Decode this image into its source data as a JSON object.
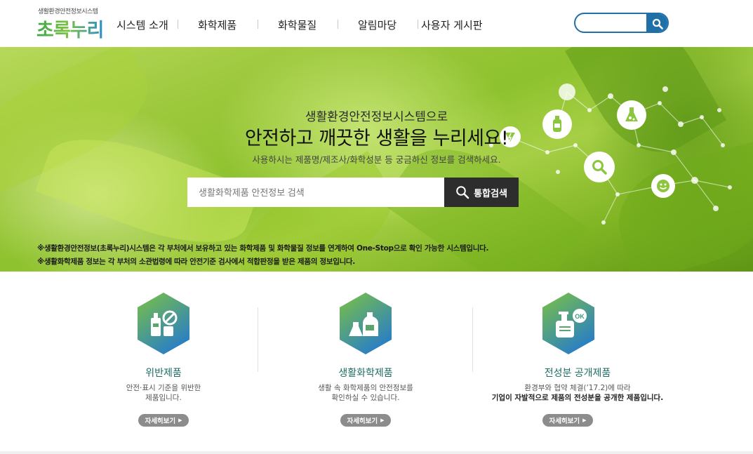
{
  "header": {
    "logo_sub": "생활환경안전정보시스템",
    "logo_main": "초록누리",
    "nav": [
      "시스템 소개",
      "화학제품",
      "화학물질",
      "알림마당",
      "사용자 게시판"
    ],
    "search_placeholder": ""
  },
  "hero": {
    "subtitle": "생활환경안전정보시스템으로",
    "title": "안전하고 깨끗한 생활을 누리세요!",
    "description": "사용하시는 제품명/제조사/화학성분 등 궁금하신 정보를 검색하세요.",
    "search_placeholder": "생활화학제품 안전정보 검색",
    "search_button": "통합검색",
    "notes": [
      "※생활환경안전정보(초록누리)시스템은 각 부처에서 보유하고 있는 화학제품 및 화학물질 정보를 연계하여 One-Stop으로 확인 가능한 시스템입니다.",
      "※생활화학제품 정보는 각 부처의 소관법령에 따라 안전기준 검사에서 적합판정을 받은 제품의 정보입니다."
    ],
    "icons": [
      "bottle-icon",
      "flask-icon",
      "lightning-icon",
      "magnifier-icon",
      "smiley-icon"
    ]
  },
  "cards": [
    {
      "title": "위반제품",
      "desc_line1": "안전·표시 기준을 위반한",
      "desc_line2": "제품입니다.",
      "button": "자세히보기",
      "icon": "prohibited-product-icon"
    },
    {
      "title": "생활화학제품",
      "desc_line1": "생활 속 화학제품의 안전정보를",
      "desc_line2": "확인하실 수 있습니다.",
      "button": "자세히보기",
      "icon": "chemical-products-icon"
    },
    {
      "title": "전성분 공개제품",
      "desc_line1": "환경부와 협약 체결(’17.2)에 따라",
      "desc_line2": "기업이 자발적으로 제품의 전성분을 공개한 제품입니다.",
      "button": "자세히보기",
      "icon": "ok-product-icon"
    }
  ],
  "colors": {
    "accent_blue": "#1f6fa8",
    "card_title": "#1c6d64",
    "hex_gradient_top": "#7cc242",
    "hex_gradient_bottom": "#2a7fc4"
  }
}
